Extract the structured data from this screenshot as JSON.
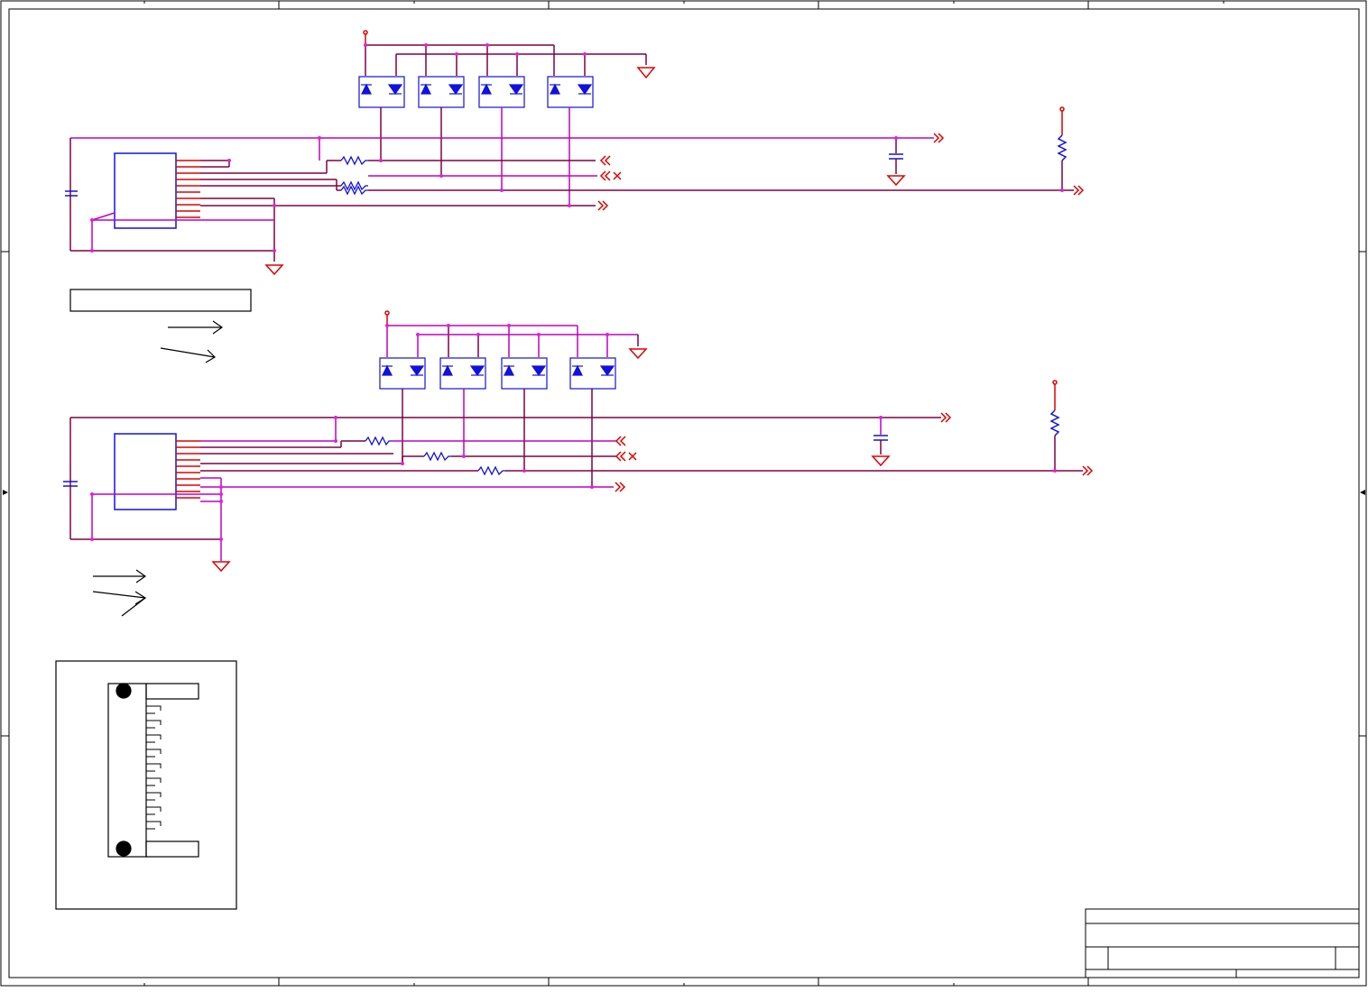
{
  "sheet": {
    "texts": []
  },
  "colors": {
    "net_wire": "#800040",
    "component_wire": "#c000c0",
    "pin": "#e00000",
    "part_body": "#1010e0",
    "border": "#000000",
    "junction": "#e020e0"
  },
  "icons": [
    "ground-icon",
    "power-port-icon",
    "resistor-icon",
    "capacitor-icon",
    "tvs-diode-icon",
    "off-page-connector-icon",
    "connector-ic-icon",
    "arrow-icon",
    "no-connect-icon"
  ]
}
